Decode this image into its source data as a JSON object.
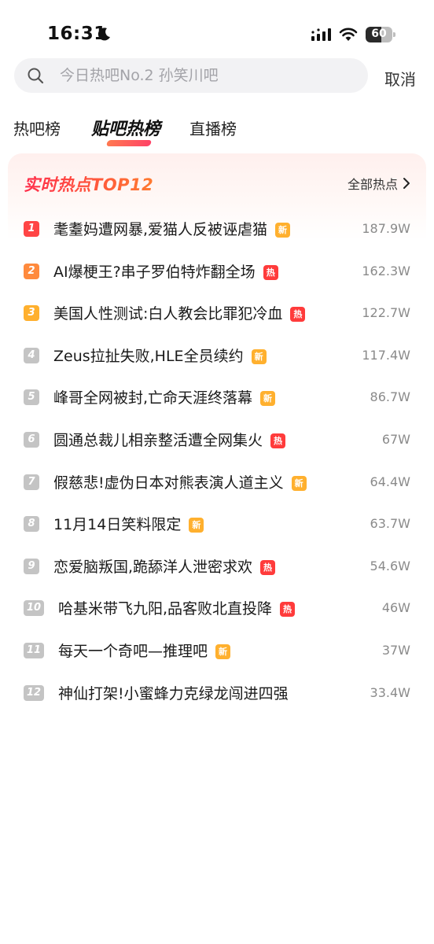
{
  "status_bar": {
    "time": "16:31",
    "battery_level": "60",
    "icons": [
      "moon-icon",
      "signal-icon",
      "wifi-icon",
      "battery-icon"
    ]
  },
  "search": {
    "placeholder": "今日热吧No.2 孙笑川吧",
    "value": "",
    "cancel_label": "取消"
  },
  "tabs": [
    {
      "label": "热吧榜",
      "active": false
    },
    {
      "label": "贴吧热榜",
      "active": true
    },
    {
      "label": "直播榜",
      "active": false
    }
  ],
  "card": {
    "title": "实时热点TOP12",
    "see_all_label": "全部热点"
  },
  "colors": {
    "rank1": "#ff4545",
    "rank2": "#ff8a3d",
    "rank3": "#ffb02e",
    "rank_other": "#c4c4c4",
    "tag_new": "#ffb02e",
    "tag_hot": "#ff3b3b"
  },
  "hot_items": [
    {
      "rank": "1",
      "title": "耄耋妈遭网暴,爱猫人反被诬虐猫",
      "tag": "新",
      "tag_type": "new",
      "hits": "187.9W"
    },
    {
      "rank": "2",
      "title": "AI爆梗王?串子罗伯特炸翻全场",
      "tag": "热",
      "tag_type": "hot",
      "hits": "162.3W"
    },
    {
      "rank": "3",
      "title": "美国人性测试:白人教会比罪犯冷血",
      "tag": "热",
      "tag_type": "hot",
      "hits": "122.7W"
    },
    {
      "rank": "4",
      "title": "Zeus拉扯失败,HLE全员续约",
      "tag": "新",
      "tag_type": "new",
      "hits": "117.4W"
    },
    {
      "rank": "5",
      "title": "峰哥全网被封,亡命天涯终落幕",
      "tag": "新",
      "tag_type": "new",
      "hits": "86.7W"
    },
    {
      "rank": "6",
      "title": "圆通总裁儿相亲整活遭全网集火",
      "tag": "热",
      "tag_type": "hot",
      "hits": "67W"
    },
    {
      "rank": "7",
      "title": "假慈悲!虚伪日本对熊表演人道主义",
      "tag": "新",
      "tag_type": "new",
      "hits": "64.4W"
    },
    {
      "rank": "8",
      "title": "11月14日笑料限定",
      "tag": "新",
      "tag_type": "new",
      "hits": "63.7W"
    },
    {
      "rank": "9",
      "title": "恋爱脑叛国,跪舔洋人泄密求欢",
      "tag": "热",
      "tag_type": "hot",
      "hits": "54.6W"
    },
    {
      "rank": "10",
      "title": "哈基米带飞九阳,品客败北直投降",
      "tag": "热",
      "tag_type": "hot",
      "hits": "46W"
    },
    {
      "rank": "11",
      "title": "每天一个奇吧—推理吧",
      "tag": "新",
      "tag_type": "new",
      "hits": "37W"
    },
    {
      "rank": "12",
      "title": "神仙打架!小蜜蜂力克绿龙闯进四强",
      "tag": "",
      "tag_type": "none",
      "hits": "33.4W"
    }
  ]
}
